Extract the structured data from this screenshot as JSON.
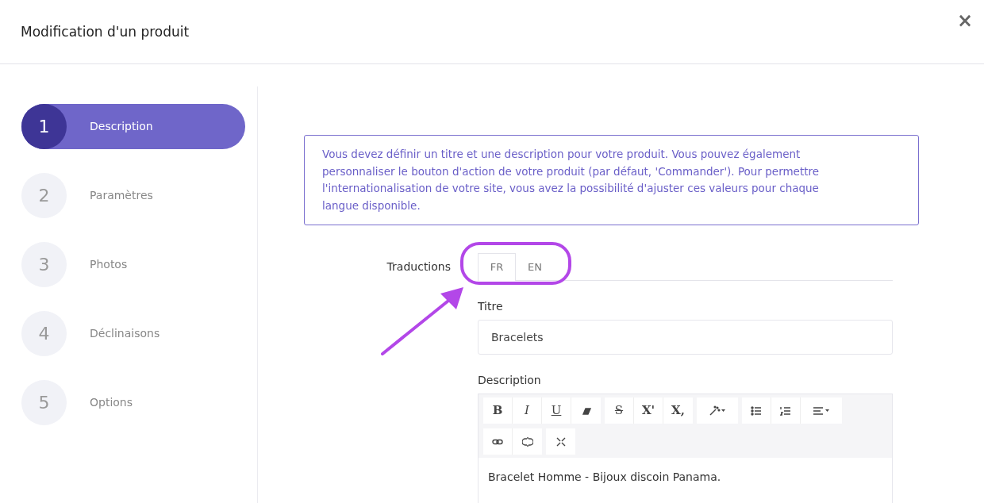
{
  "modal": {
    "title": "Modification d'un produit",
    "close": "×"
  },
  "steps": [
    {
      "number": "1",
      "label": "Description",
      "selected": true
    },
    {
      "number": "2",
      "label": "Paramètres",
      "selected": false
    },
    {
      "number": "3",
      "label": "Photos",
      "selected": false
    },
    {
      "number": "4",
      "label": "Déclinaisons",
      "selected": false
    },
    {
      "number": "5",
      "label": "Options",
      "selected": false
    }
  ],
  "info": "Vous devez définir un titre et une description pour votre produit. Vous pouvez également personnaliser le bouton d'action de votre produit (par défaut, 'Commander'). Pour permettre l'internationalisation de votre site, vous avez la possibilité d'ajuster ces valeurs pour chaque langue disponible.",
  "translations": {
    "label": "Traductions",
    "tabs": [
      {
        "label": "FR",
        "selected": true
      },
      {
        "label": "EN",
        "selected": false
      }
    ]
  },
  "title_field": {
    "label": "Titre",
    "value": "Bracelets"
  },
  "description": {
    "label": "Description",
    "toolbar_rows": [
      [
        [
          {
            "kind": "bold",
            "label": "B"
          },
          {
            "kind": "italic",
            "label": "I"
          },
          {
            "kind": "underline",
            "label": "U"
          },
          {
            "kind": "eraser"
          }
        ],
        [
          {
            "kind": "strike",
            "label": "S"
          },
          {
            "kind": "superscript",
            "label": "X'"
          },
          {
            "kind": "subscript",
            "label": "X,"
          }
        ],
        [
          {
            "kind": "magic"
          }
        ],
        [
          {
            "kind": "ul"
          },
          {
            "kind": "ol"
          },
          {
            "kind": "align"
          }
        ]
      ],
      [
        [
          {
            "kind": "link"
          },
          {
            "kind": "unlink"
          }
        ],
        [
          {
            "kind": "fullscreen"
          }
        ]
      ]
    ],
    "text": "Bracelet Homme - Bijoux discoin Panama."
  }
}
